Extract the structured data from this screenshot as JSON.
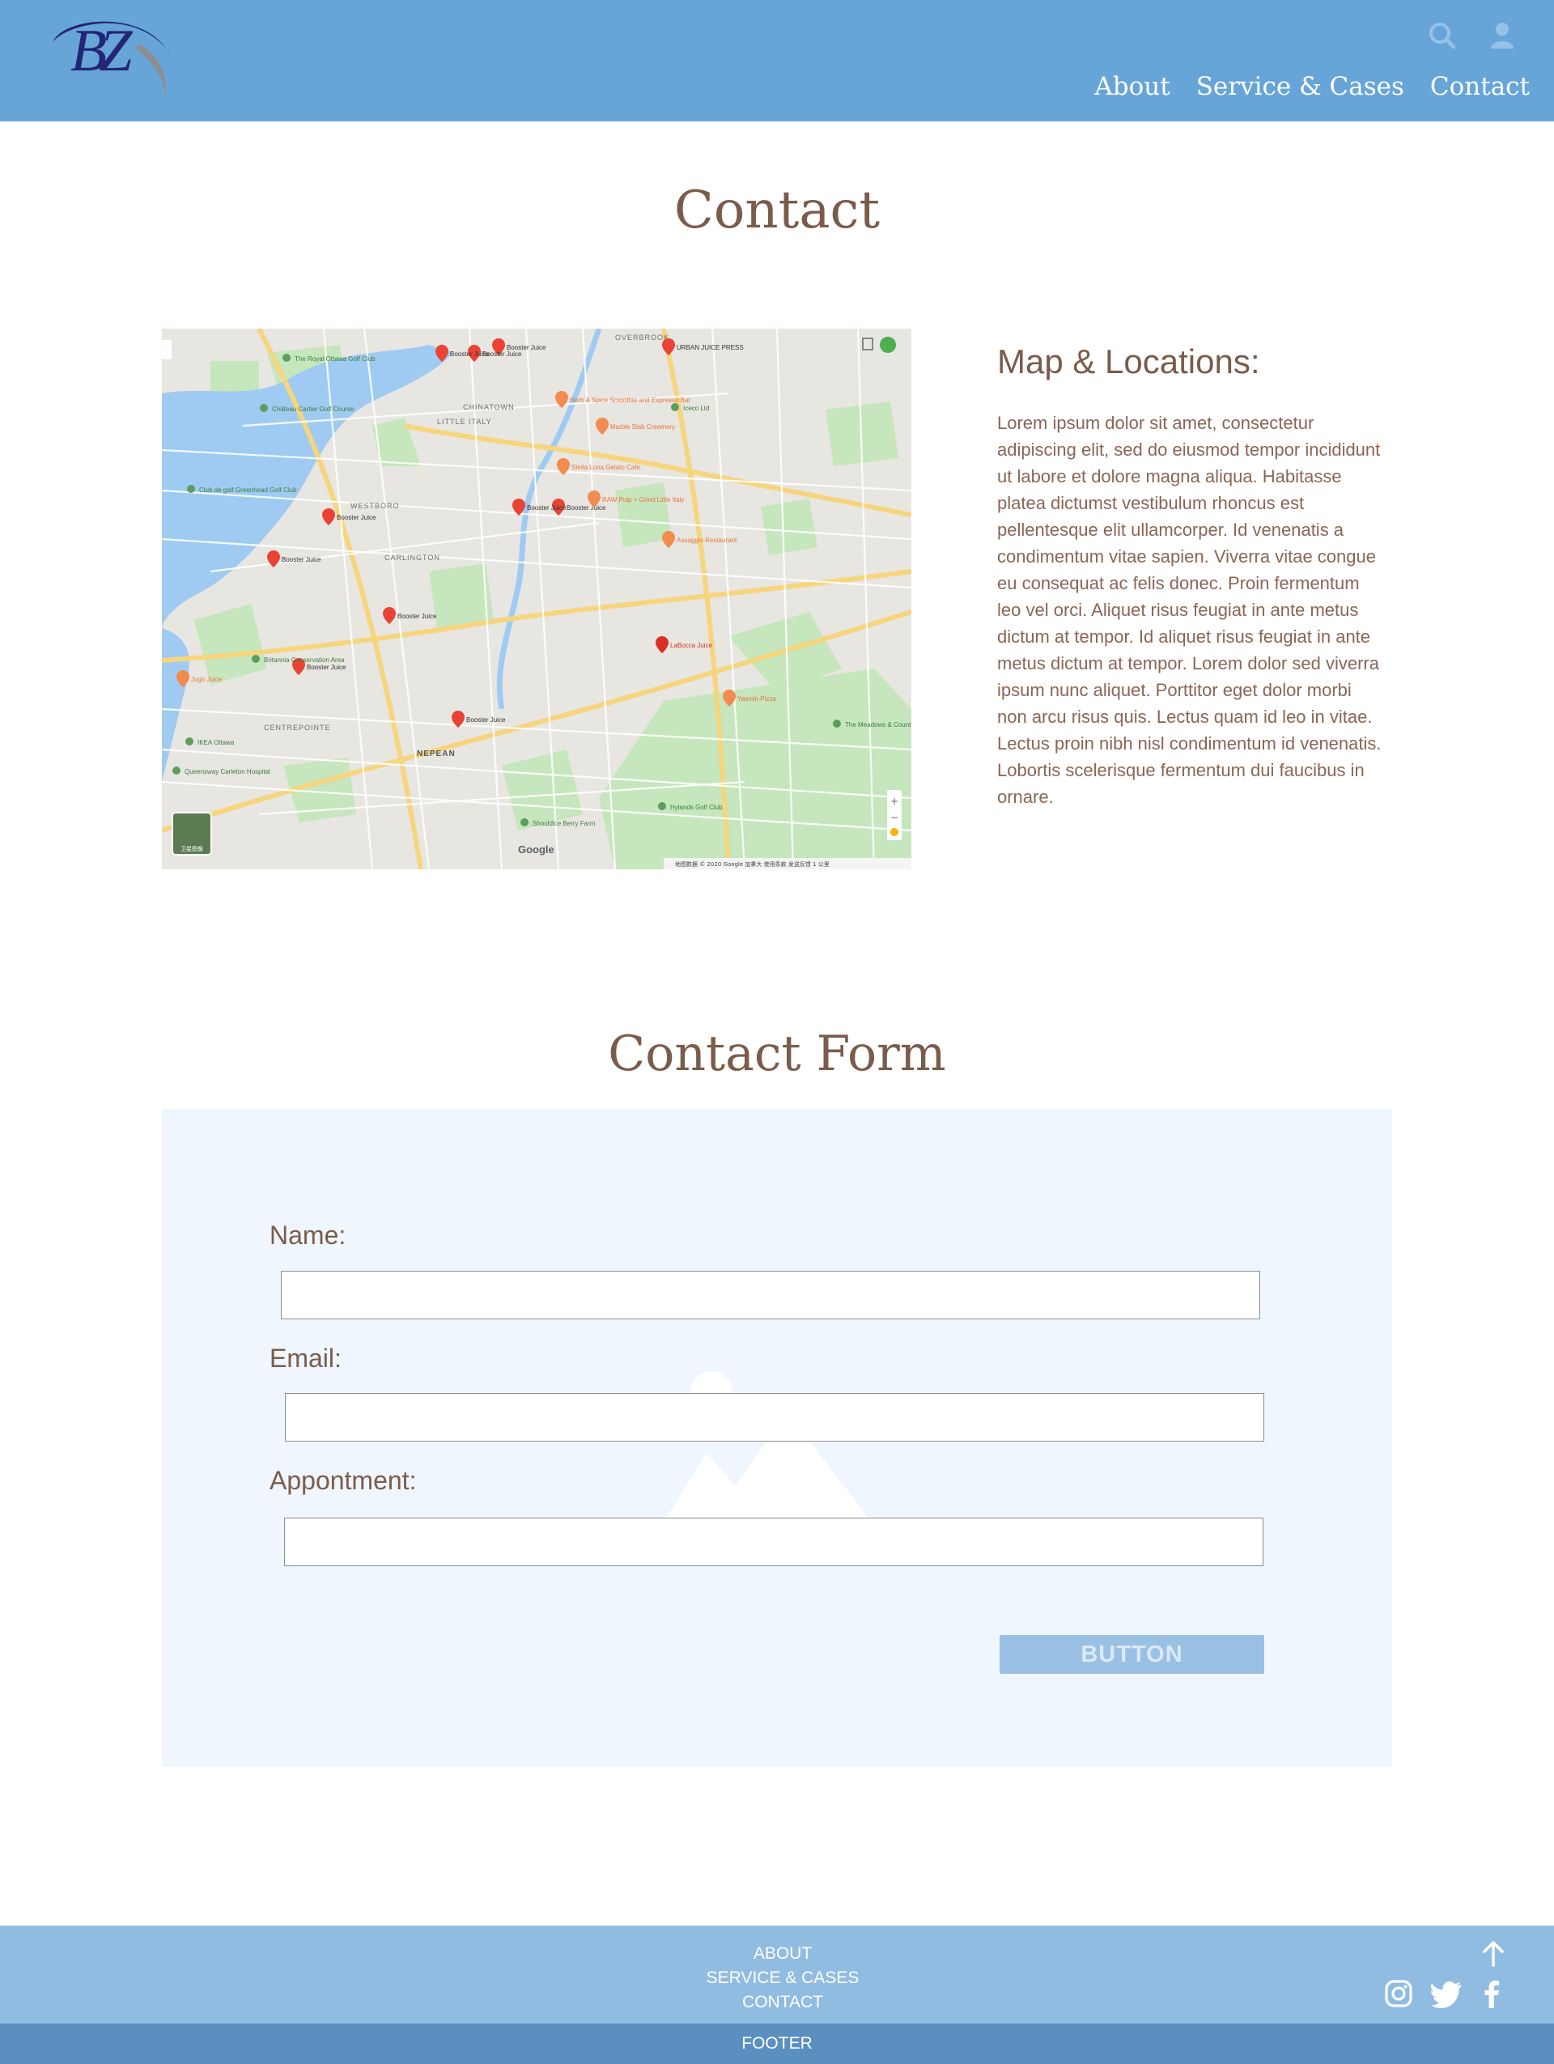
{
  "brand": {
    "logo_text": "BZ",
    "primary_color": "#67a5d8",
    "text_color": "#7b5c4a"
  },
  "header": {
    "icons": [
      "search-icon",
      "user-icon"
    ],
    "nav": [
      {
        "label": "About"
      },
      {
        "label": "Service & Cases"
      },
      {
        "label": "Contact"
      }
    ]
  },
  "contact": {
    "title": "Contact",
    "map": {
      "places": [
        "Booster Juice",
        "Booster Juice",
        "Booster Juice",
        "Booster Juice",
        "Booster Juice",
        "Booster Juice",
        "Booster Juice",
        "Booster Juice",
        "Booster Juice",
        "Booster Juice",
        "URBAN JUICE PRESS",
        "Herb & Spice Smoothie and Espresso Bar",
        "RAW Pulp + Grind Little Italy",
        "Marble Slab Creamery",
        "Stella Luna Gelato Cafe",
        "Assaggio Restaurant",
        "LaBocca Juice",
        "Yasmin Pizza",
        "Jugo Juice",
        "Iceco Ltd",
        "IKEA Ottawa",
        "Queensway Carleton Hospital",
        "Hylands Golf Club",
        "Shouldice Berry Farm",
        "The Royal Ottawa Golf Club",
        "Château Cartier Golf Course",
        "Club de golf Greenhead Golf Club",
        "Britannia Conservation Area",
        "The Meadows & Country"
      ],
      "districts": [
        "OVERBROOK",
        "CHINATOWN",
        "LITTLE ITALY",
        "WESTBORO",
        "CARLINGTON",
        "CENTREPOINTE",
        "NEPEAN"
      ],
      "attribution": "Google",
      "footer_text": "地图数据 © 2020 Google   加拿大   使用条款   发送反馈   1 公里",
      "layer_label": "卫星图像"
    },
    "locations_heading": "Map & Locations:",
    "locations_text": "Lorem ipsum dolor sit amet, consectetur adipiscing elit, sed do eiusmod tempor incididunt ut labore et dolore magna aliqua. Habitasse platea dictumst vestibulum rhoncus est pellentesque elit ullamcorper. Id venenatis a condimentum vitae sapien. Viverra vitae congue eu consequat ac felis donec. Proin fermentum leo vel orci. Aliquet risus feugiat in ante metus dictum at tempor. Id aliquet risus feugiat in ante metus dictum at tempor. Lorem dolor sed viverra ipsum nunc aliquet. Porttitor eget dolor morbi non arcu risus quis. Lectus quam id leo in vitae. Lectus proin nibh nisl condimentum id venenatis. Lobortis scelerisque fermentum dui faucibus in ornare."
  },
  "form": {
    "title": "Contact Form",
    "fields": [
      {
        "label": "Name:",
        "value": ""
      },
      {
        "label": "Email:",
        "value": ""
      },
      {
        "label": "Appontment:",
        "value": ""
      }
    ],
    "button_label": "BUTTON"
  },
  "footer": {
    "links": [
      "ABOUT",
      "SERVICE & CASES",
      "CONTACT"
    ],
    "icons": [
      "arrow-up-icon",
      "instagram-icon",
      "twitter-icon",
      "facebook-icon"
    ],
    "bar_label": "FOOTER"
  }
}
